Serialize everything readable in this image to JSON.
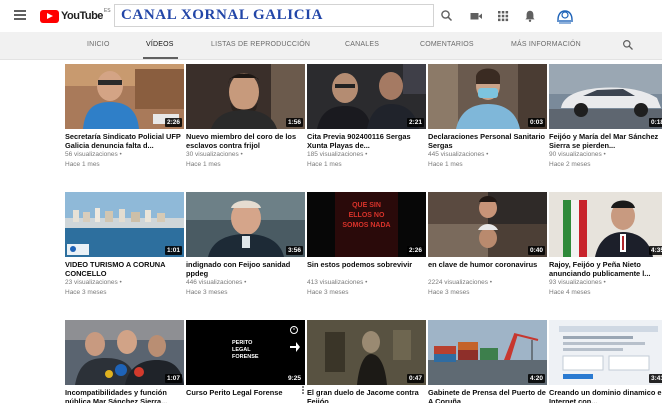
{
  "masthead": {
    "logo_text": "YouTube",
    "logo_country": "ES",
    "channel_banner": "CANAL XORNAL GALICIA"
  },
  "tabs": [
    {
      "label": "INICIO",
      "active": false
    },
    {
      "label": "VÍDEOS",
      "active": true
    },
    {
      "label": "LISTAS DE REPRODUCCIÓN",
      "active": false
    },
    {
      "label": "CANALES",
      "active": false
    },
    {
      "label": "COMENTARIOS",
      "active": false
    },
    {
      "label": "MÁS INFORMACIÓN",
      "active": false
    }
  ],
  "videos": [
    {
      "title": "Secretaría Sindicato Policial UFP Galicia denuncia falta d...",
      "views": "56 visualizaciones",
      "age": "Hace 1 mes",
      "duration": "2:26"
    },
    {
      "title": "Nuevo miembro del coro de los esclavos contra frijol",
      "views": "30 visualizaciones",
      "age": "Hace 1 mes",
      "duration": "1:56"
    },
    {
      "title": "Cita Previa 902400116 Sergas Xunta Playas de...",
      "views": "185 visualizaciones",
      "age": "Hace 1 mes",
      "duration": "2:21"
    },
    {
      "title": "Declaraciones Personal Sanitario Sergas",
      "views": "445 visualizaciones",
      "age": "Hace 1 mes",
      "duration": "0:03"
    },
    {
      "title": "Feijóo y María del Mar Sánchez Sierra se pierden...",
      "views": "90 visualizaciones",
      "age": "Hace 2 meses",
      "duration": "0:18"
    },
    {
      "title": "VIDEO TURISMO A CORUNA CONCELLO",
      "views": "23 visualizaciones",
      "age": "Hace 3 meses",
      "duration": "1:01"
    },
    {
      "title": "indignado con Feijoo sanidad ppdeg",
      "views": "446 visualizaciones",
      "age": "Hace 3 meses",
      "duration": "3:56"
    },
    {
      "title": "Sin estos podemos sobrevivir",
      "views": "413 visualizaciones",
      "age": "Hace 3 meses",
      "duration": "2:26"
    },
    {
      "title": "en clave de humor coronavirus",
      "views": "2224 visualizaciones",
      "age": "Hace 3 meses",
      "duration": "0:40"
    },
    {
      "title": "Rajoy, Feijóo y Peña Nieto anunciando publicamente l...",
      "views": "93 visualizaciones",
      "age": "Hace 4 meses",
      "duration": "4:35"
    },
    {
      "title": "Incompatibilidades y función pública Mar Sánchez Sierra...",
      "views": "",
      "age": "",
      "duration": "1:07"
    },
    {
      "title": "Curso Perito Legal Forense",
      "views": "",
      "age": "",
      "duration": "9:25"
    },
    {
      "title": "El gran duelo de Jacome contra Feijóo",
      "views": "",
      "age": "",
      "duration": "0:47"
    },
    {
      "title": "Gabinete de Prensa del Puerto de A Coruña",
      "views": "",
      "age": "",
      "duration": "4:20"
    },
    {
      "title": "Creando un dominio dinamico en Internet con...",
      "views": "",
      "age": "",
      "duration": "3:41"
    }
  ],
  "thumb_texts": {
    "video_8_overlay": "QUE SIN ELLOS NO SOMOS NADA",
    "video_12_overlay": "PERITO LEGAL FORENSE"
  },
  "colors": {
    "accent": "#ff0000",
    "banner_text": "#2246a8"
  }
}
